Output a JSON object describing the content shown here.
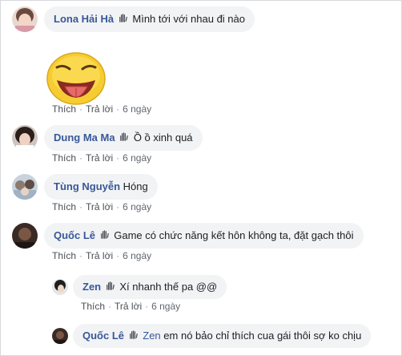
{
  "labels": {
    "like": "Thích",
    "reply": "Trả lời",
    "sep": "·"
  },
  "comments": [
    {
      "author": "Lona Hải Hà",
      "text": "Mình tới với nhau đi nào",
      "time": "6 ngày"
    },
    {
      "author": "Dung Ma Ma",
      "text": "Ồ ồ xinh quá",
      "time": "6 ngày"
    },
    {
      "author": "Tùng Nguyễn",
      "text": "Hóng",
      "time": "6 ngày"
    },
    {
      "author": "Quốc Lê",
      "text": "Game có chức năng kết hôn không ta, đặt gạch thôi",
      "time": "6 ngày"
    }
  ],
  "replies": [
    {
      "author": "Zen",
      "text": "Xí nhanh thế pa @@",
      "time": "6 ngày"
    },
    {
      "author": "Quốc Lê",
      "mention": "Zen",
      "text": "em nó bảo chỉ thích cua gái thôi sợ ko chịu"
    }
  ]
}
